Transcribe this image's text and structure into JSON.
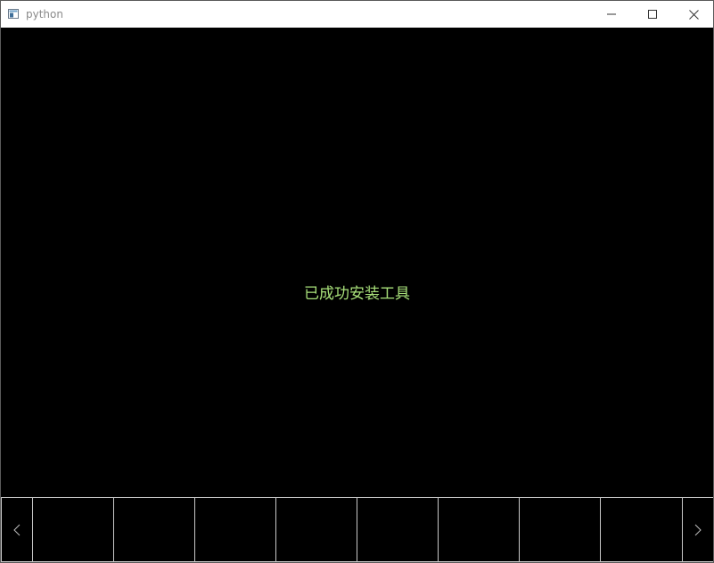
{
  "window": {
    "title": "python",
    "icon": "python-app-icon",
    "controls": {
      "minimize_icon": "minimize-icon",
      "maximize_icon": "maximize-icon",
      "close_icon": "close-icon"
    }
  },
  "main": {
    "message": "已成功安装工具",
    "message_color": "#a8e07a",
    "background": "#000000"
  },
  "thumbnail_strip": {
    "prev_icon": "chevron-left-icon",
    "next_icon": "chevron-right-icon",
    "slot_count": 8
  }
}
